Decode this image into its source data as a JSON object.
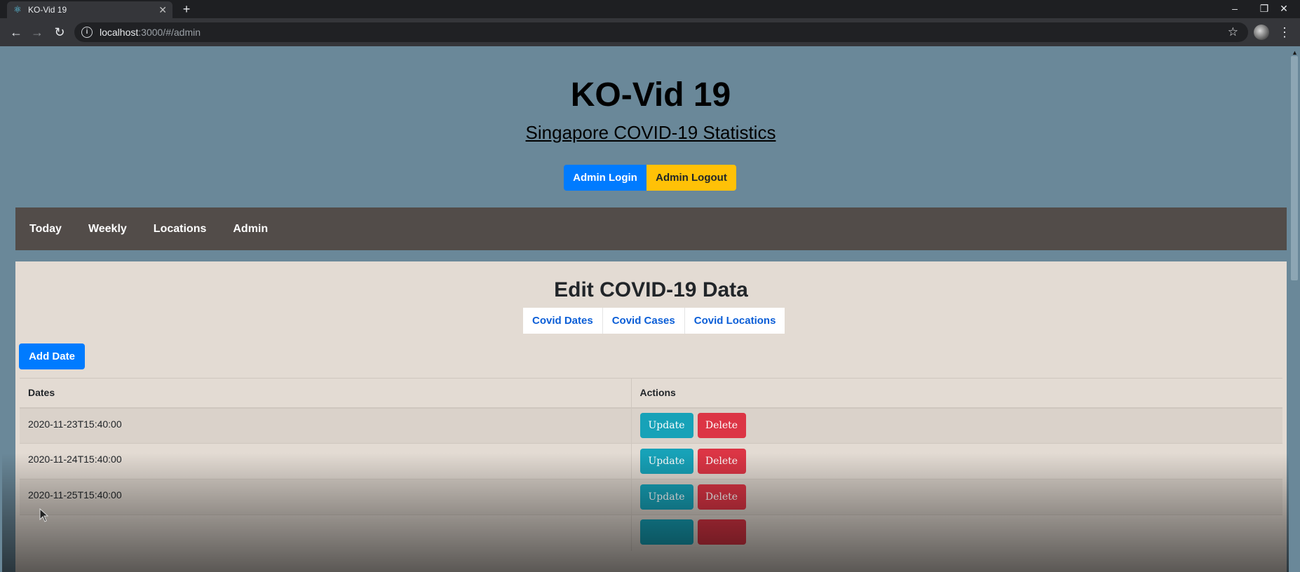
{
  "browser": {
    "tab_title": "KO-Vid 19",
    "new_tab": "+",
    "url_host": "localhost",
    "url_path": ":3000/#/admin",
    "window_controls": [
      "–",
      "❐",
      "✕"
    ]
  },
  "header": {
    "title": "KO-Vid 19",
    "subtitle": "Singapore COVID-19 Statistics",
    "login_label": "Admin Login",
    "logout_label": "Admin Logout"
  },
  "nav": {
    "items": [
      {
        "label": "Today"
      },
      {
        "label": "Weekly"
      },
      {
        "label": "Locations"
      },
      {
        "label": "Admin"
      }
    ]
  },
  "admin": {
    "title": "Edit COVID-19 Data",
    "tabs": [
      {
        "label": "Covid Dates"
      },
      {
        "label": "Covid Cases"
      },
      {
        "label": "Covid Locations"
      }
    ],
    "add_label": "Add Date",
    "table": {
      "headers": [
        "Dates",
        "Actions"
      ],
      "rows": [
        {
          "date": "2020-11-23T15:40:00",
          "update": "Update",
          "delete": "Delete"
        },
        {
          "date": "2020-11-24T15:40:00",
          "update": "Update",
          "delete": "Delete"
        },
        {
          "date": "2020-11-25T15:40:00",
          "update": "Update",
          "delete": "Delete"
        },
        {
          "date": "",
          "update": "",
          "delete": ""
        }
      ]
    }
  },
  "colors": {
    "page_bg": "#6a8899",
    "nav_bg": "#524c49",
    "panel_bg": "#e3dbd3",
    "primary": "#007bff",
    "warning": "#ffc107",
    "info": "#17a2b8",
    "danger": "#dc3545"
  }
}
